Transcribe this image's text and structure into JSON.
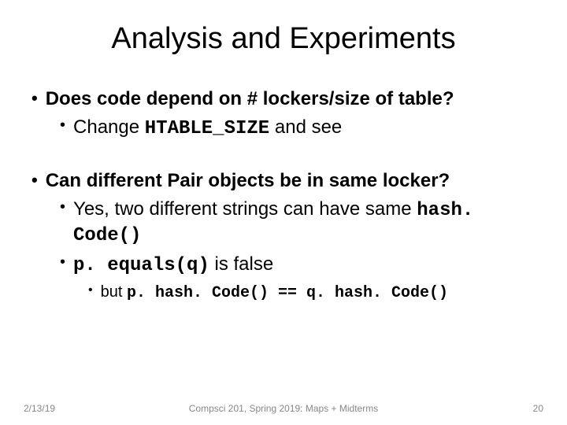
{
  "title": "Analysis and Experiments",
  "b1": {
    "q": "Does code depend on # lockers/size of table?",
    "sub": {
      "pre": "Change ",
      "code": "HTABLE_SIZE",
      "post": " and see"
    }
  },
  "b2": {
    "q": "Can different Pair objects be in same locker?",
    "sub1": {
      "pre": "Yes, two different strings can have same ",
      "code": "hash. Code()"
    },
    "sub2": {
      "code": "p. equals(q)",
      "post": " is false"
    },
    "sub3": {
      "pre": "but ",
      "code": "p. hash. Code() == q. hash. Code()"
    }
  },
  "footer": {
    "date": "2/13/19",
    "center": "Compsci 201, Spring 2019: Maps + Midterms",
    "page": "20"
  }
}
